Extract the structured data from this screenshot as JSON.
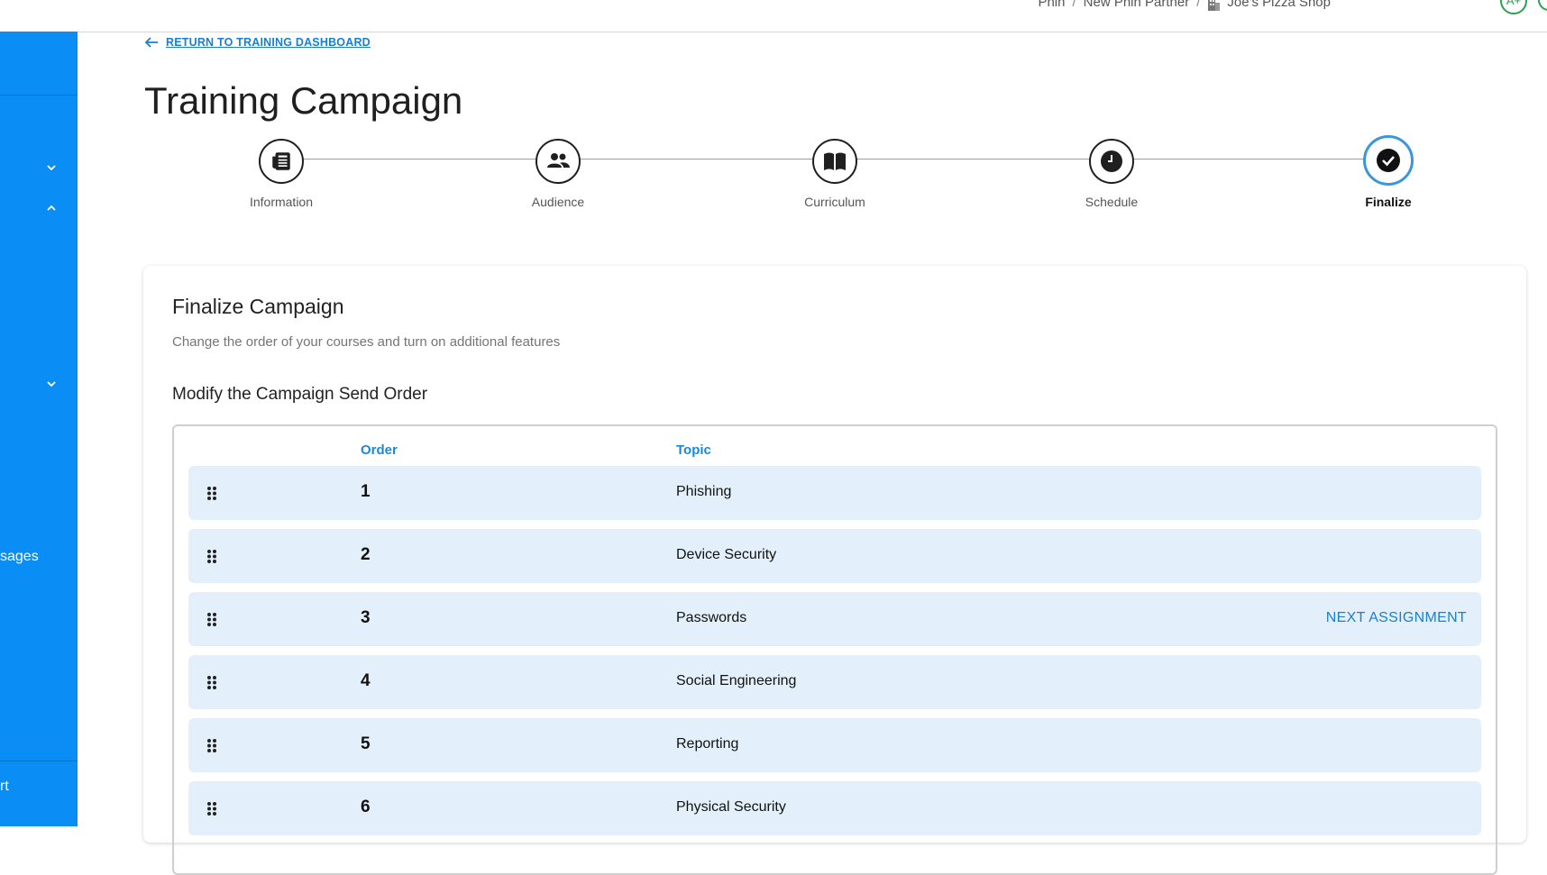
{
  "breadcrumb": {
    "items": [
      "Phin",
      "New Phin Partner",
      "Joe's Pizza Shop"
    ],
    "separator": "/"
  },
  "avatar": {
    "initials": "A+"
  },
  "sidebar": {
    "partial_labels": [
      "sages",
      "rt"
    ]
  },
  "back_link": {
    "label": "RETURN TO TRAINING DASHBOARD"
  },
  "page_title": "Training Campaign",
  "stepper": {
    "steps": [
      {
        "label": "Information",
        "icon": "newspaper-icon"
      },
      {
        "label": "Audience",
        "icon": "people-icon"
      },
      {
        "label": "Curriculum",
        "icon": "book-icon"
      },
      {
        "label": "Schedule",
        "icon": "clock-icon"
      },
      {
        "label": "Finalize",
        "icon": "check-circle-icon",
        "active": true
      }
    ]
  },
  "card": {
    "title": "Finalize Campaign",
    "subtitle": "Change the order of your courses and turn on additional features",
    "section_title": "Modify the Campaign Send Order",
    "table": {
      "headers": {
        "order": "Order",
        "topic": "Topic"
      },
      "rows": [
        {
          "order": "1",
          "topic": "Phishing"
        },
        {
          "order": "2",
          "topic": "Device Security"
        },
        {
          "order": "3",
          "topic": "Passwords",
          "action": "NEXT ASSIGNMENT"
        },
        {
          "order": "4",
          "topic": "Social Engineering"
        },
        {
          "order": "5",
          "topic": "Reporting"
        },
        {
          "order": "6",
          "topic": "Physical Security"
        }
      ]
    }
  },
  "colors": {
    "sidebar": "#0a8ef5",
    "accent": "#1a7fd0",
    "row_bg": "#e3f0fb",
    "active_step_ring": "#3a96dd",
    "avatar_ring": "#2e9e4f"
  }
}
